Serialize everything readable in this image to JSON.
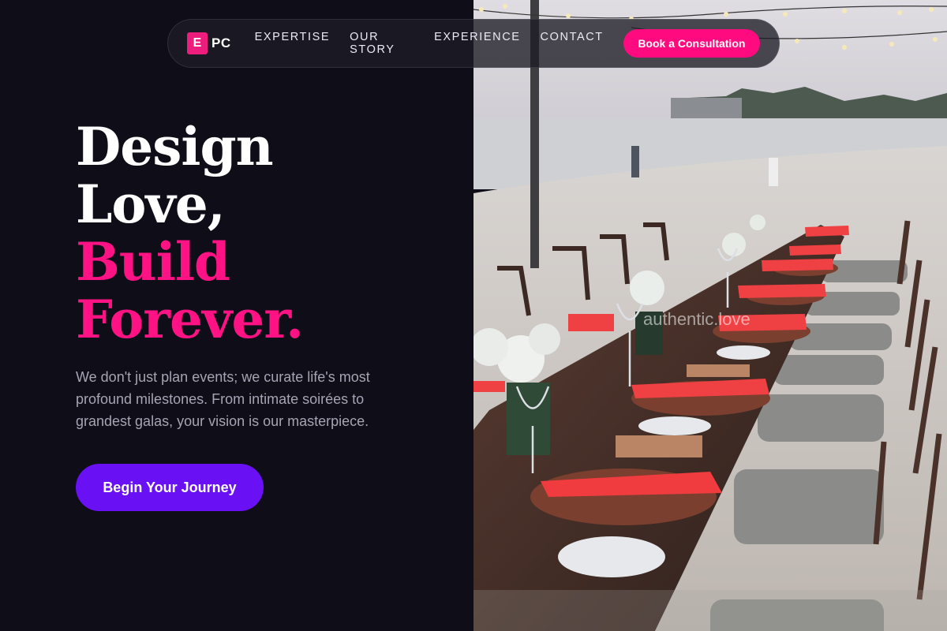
{
  "brand": {
    "logo_mark": "E",
    "logo_text": "PC",
    "accent": "#ff1283",
    "cta_purple": "#6a10f5"
  },
  "nav": {
    "links": [
      "EXPERTISE",
      "OUR STORY",
      "EXPERIENCE",
      "CONTACT"
    ],
    "cta_label": "Book a Consultation"
  },
  "hero": {
    "headline_line1": "Design",
    "headline_line2": "Love,",
    "headline_line3": "Build",
    "headline_line4": "Forever.",
    "subtext": "We don't just plan events; we curate life's most profound milestones. From intimate soirées to grandest galas, your vision is our masterpiece.",
    "cta_label": "Begin Your Journey"
  },
  "photo": {
    "watermark": "authentic.love"
  }
}
